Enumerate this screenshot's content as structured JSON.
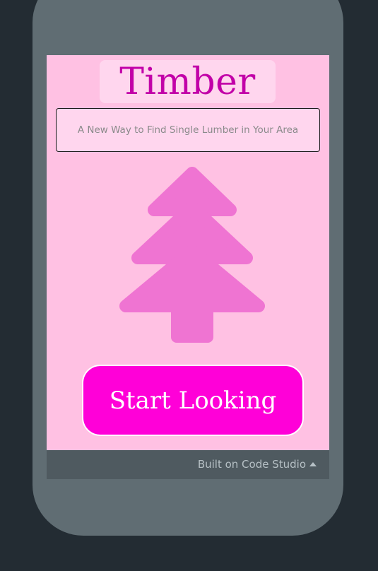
{
  "app": {
    "title": "Timber",
    "tagline": "A New Way to Find Single Lumber in Your Area",
    "start_button_label": "Start Looking",
    "logo_icon": "pine-tree-icon"
  },
  "footer": {
    "built_on_label": "Built on Code Studio",
    "toggle_icon": "caret-up-icon"
  },
  "colors": {
    "background": "#232c33",
    "phone_frame": "#606d73",
    "screen": "#ffc1e3",
    "title_text": "#c200a8",
    "tree": "#ef74d2",
    "button": "#ff00d8",
    "footer_bar": "#4f5a60"
  }
}
